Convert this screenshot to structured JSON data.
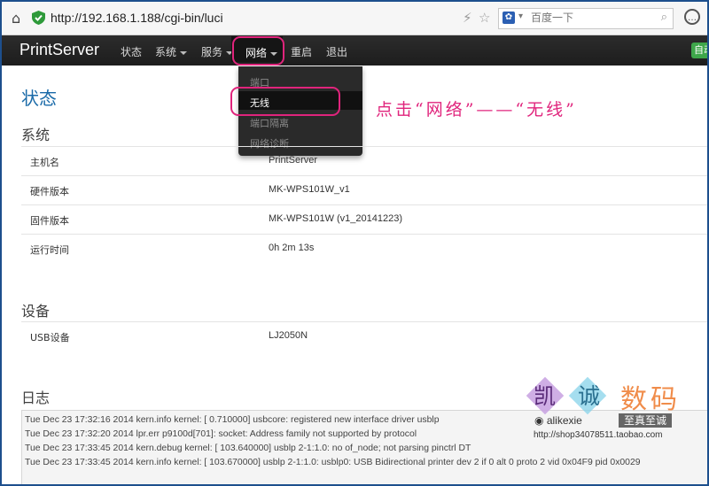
{
  "browser": {
    "url": "http://192.168.1.188/cgi-bin/luci",
    "search_placeholder": "百度一下"
  },
  "nav": {
    "brand": "PrintServer",
    "items": [
      {
        "label": "状态",
        "has_caret": false
      },
      {
        "label": "系统",
        "has_caret": true
      },
      {
        "label": "服务",
        "has_caret": true
      },
      {
        "label": "网络",
        "has_caret": true
      },
      {
        "label": "重启",
        "has_caret": false
      },
      {
        "label": "退出",
        "has_caret": false
      }
    ],
    "badge": "自动"
  },
  "dropdown": {
    "items": [
      "端口",
      "无线",
      "端口隔离",
      "网络诊断"
    ],
    "highlighted": "无线"
  },
  "annotation": {
    "text": "点击“网络”——“无线”",
    "color": "#e0247c"
  },
  "page": {
    "title": "状态",
    "system": {
      "title": "系统",
      "rows": [
        {
          "key": "主机名",
          "value": "PrintServer"
        },
        {
          "key": "硬件版本",
          "value": "MK-WPS101W_v1"
        },
        {
          "key": "固件版本",
          "value": "MK-WPS101W (v1_20141223)"
        },
        {
          "key": "运行时间",
          "value": "0h 2m 13s"
        }
      ]
    },
    "device": {
      "title": "设备",
      "rows": [
        {
          "key": "USB设备",
          "value": "LJ2050N"
        }
      ]
    },
    "log": {
      "title": "日志",
      "lines": [
        "Tue Dec 23 17:32:16 2014 kern.info kernel: [    0.710000] usbcore: registered new interface driver usblp",
        "Tue Dec 23 17:32:20 2014 lpr.err p9100d[701]: socket: Address family not supported by protocol",
        "Tue Dec 23 17:33:45 2014 kern.debug kernel: [  103.640000] usblp 2-1:1.0: no of_node; not parsing pinctrl DT",
        "Tue Dec 23 17:33:45 2014 kern.info kernel: [  103.670000] usblp 2-1:1.0: usblp0: USB Bidirectional printer dev 2 if 0 alt 0 proto 2 vid 0x04F9 pid 0x0029"
      ]
    }
  },
  "watermark": {
    "brand_chars": [
      "凯",
      "诚",
      "数码"
    ],
    "handle": "alikexie",
    "slogan": "至真至诚",
    "shop_url": "http://shop34078511.taobao.com"
  },
  "colors": {
    "accent": "#1a6aa8",
    "annotation": "#e0247c",
    "navbar": "#222222"
  }
}
